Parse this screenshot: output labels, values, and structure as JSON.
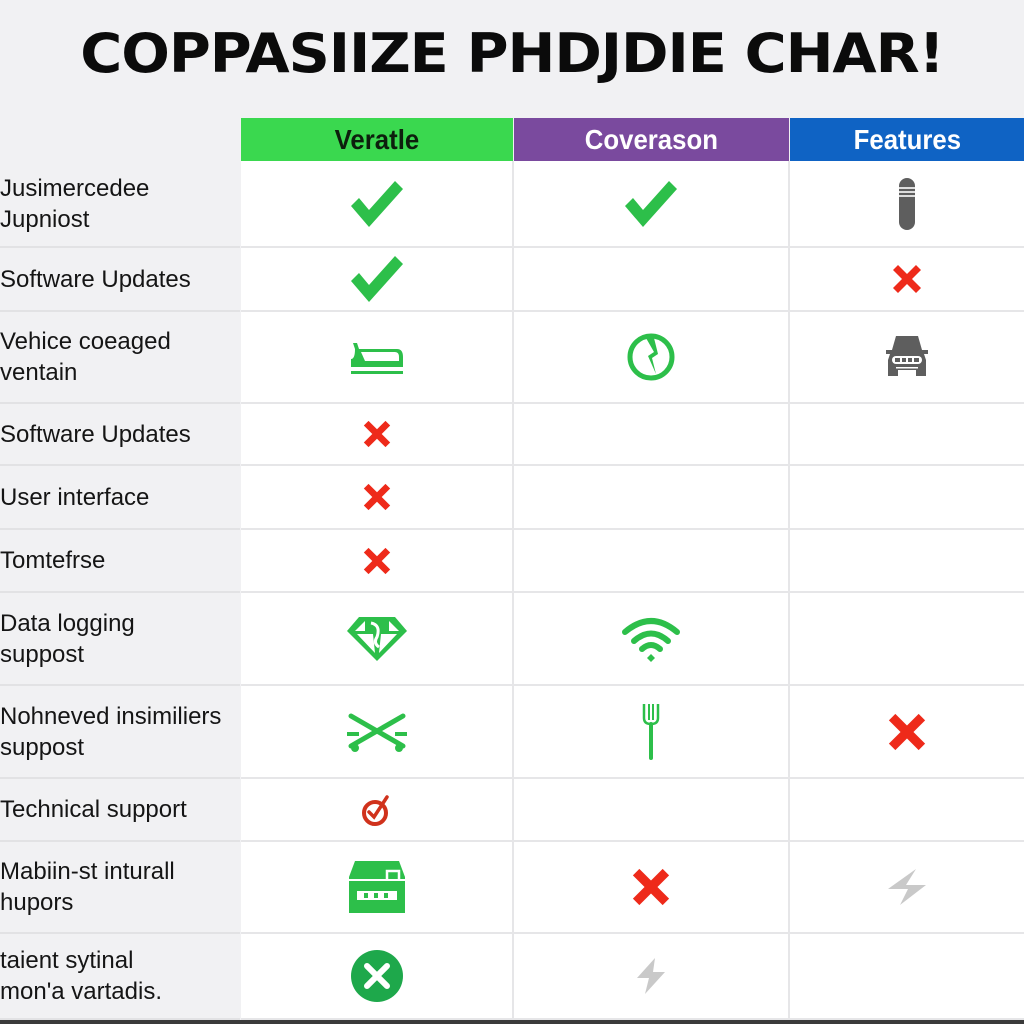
{
  "title": "COPPASIIZE PHDJDIE CHAR!",
  "columns": [
    {
      "label": "Veratle",
      "color": "#3ad84f"
    },
    {
      "label": "Coverason",
      "color": "#7a4a9e"
    },
    {
      "label": "Features",
      "color": "#0f63c4"
    }
  ],
  "rows": [
    {
      "label": "Jusimercedee\nJupniost",
      "cells": [
        "check",
        "check",
        "battery-tube"
      ]
    },
    {
      "label": "Software Updates",
      "cells": [
        "check",
        "",
        "cross"
      ]
    },
    {
      "label": "Vehice coeaged\nventain",
      "cells": [
        "iron-vehicle",
        "globe-bolt",
        "car-front"
      ]
    },
    {
      "label": "Software Updates",
      "cells": [
        "cross-small",
        "",
        ""
      ]
    },
    {
      "label": "User interface",
      "cells": [
        "cross-small",
        "",
        ""
      ]
    },
    {
      "label": "Tomtefrse",
      "cells": [
        "cross-small",
        "",
        ""
      ]
    },
    {
      "label": "Data logging\nsuppost",
      "cells": [
        "diamond",
        "wifi",
        ""
      ]
    },
    {
      "label": "Nohneved insimiliers\nsuppost",
      "cells": [
        "crossed-swords",
        "fork",
        "cross-large"
      ]
    },
    {
      "label": "Technical support",
      "cells": [
        "target-check",
        "",
        ""
      ]
    },
    {
      "label": "Mabiin-st inturall\nhupors",
      "cells": [
        "drawer-box",
        "cross-large",
        "bolt-light"
      ]
    },
    {
      "label": "taient sytinal\nmon'a vartadis.",
      "cells": [
        "circle-x",
        "bolt-gray",
        ""
      ]
    }
  ],
  "icon_colors": {
    "green": "#2dbf4a",
    "red": "#ee2a1a",
    "gray": "#5e5e5e",
    "light_gray": "#c9c9c9"
  }
}
